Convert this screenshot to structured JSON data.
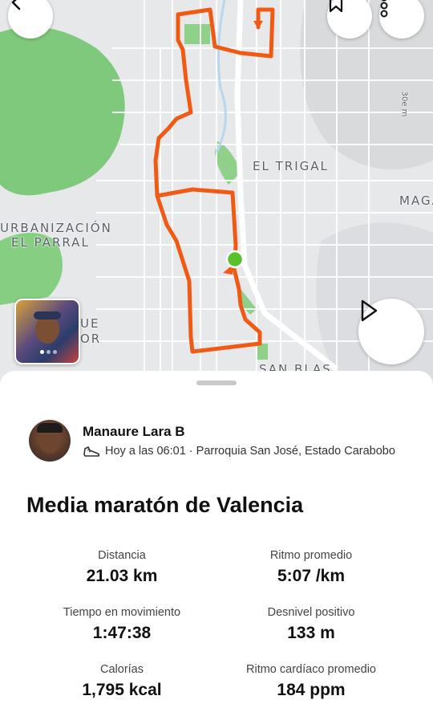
{
  "map": {
    "labels": [
      "EL TRIGAL",
      "URBANIZACIÓN",
      "EL PARRAL",
      "MAGA",
      "SAN BLAS",
      "UE",
      "OR",
      "30e m"
    ],
    "colors": {
      "route": "#f05a14",
      "start_marker": "#58c12b",
      "green_area": "#7fc97c"
    }
  },
  "toolbar": {
    "back_icon": "chevron-left-icon",
    "bookmark_icon": "bookmark-icon",
    "more_icon": "more-vertical-icon",
    "play_icon": "play-icon"
  },
  "athlete": {
    "name": "Manaure Lara B",
    "meta": "Hoy a las 06:01 · Parroquia San José, Estado Carabobo",
    "activity_icon": "shoe-icon"
  },
  "activity": {
    "title": "Media maratón de Valencia"
  },
  "stats": [
    {
      "label": "Distancia",
      "value": "21.03 km"
    },
    {
      "label": "Ritmo promedio",
      "value": "5:07 /km"
    },
    {
      "label": "Tiempo en movimiento",
      "value": "1:47:38"
    },
    {
      "label": "Desnivel positivo",
      "value": "133 m"
    },
    {
      "label": "Calorías",
      "value": "1,795 kcal"
    },
    {
      "label": "Ritmo cardíaco promedio",
      "value": "184 ppm"
    }
  ]
}
